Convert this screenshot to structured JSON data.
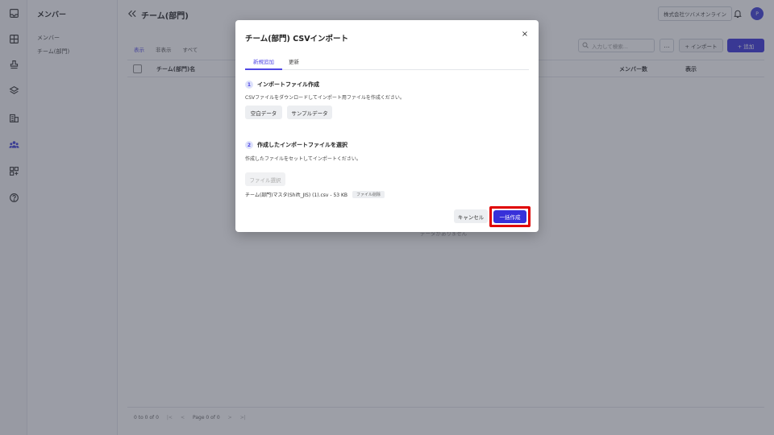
{
  "subnav": {
    "title": "メンバー",
    "items": [
      "メンバー",
      "チーム(部門)"
    ]
  },
  "main": {
    "title": "チーム(部門)",
    "company": "株式会社ツバメオンライン",
    "avatar_initial": "P",
    "tabs": [
      "表示",
      "非表示",
      "すべて"
    ],
    "search_placeholder": "入力して検索...",
    "more_label": "...",
    "import_label": "+ インポート",
    "add_label": "+ 追加",
    "columns": [
      "チーム(部門)名",
      "メンバー数",
      "表示"
    ],
    "empty_message": "データがありません",
    "pagination": {
      "range": "0 to 0 of 0",
      "page": "Page 0 of 0",
      "first": "|<",
      "prev": "<",
      "next": ">",
      "last": ">|"
    }
  },
  "modal": {
    "title": "チーム(部門) CSVインポート",
    "close": "×",
    "tabs": [
      "新規追加",
      "更新"
    ],
    "step1": {
      "num": "1",
      "title": "インポートファイル作成",
      "desc": "CSVファイルをダウンロードしてインポート用ファイルを作成ください。",
      "buttons": [
        "空白データ",
        "サンプルデータ"
      ]
    },
    "step2": {
      "num": "2",
      "title": "作成したインポートファイルを選択",
      "desc": "作成したファイルをセットしてインポートください。",
      "select_label": "ファイル選択",
      "file_name": "チーム(部門)マスタ(Shift_JIS) (1).csv - 53 KB",
      "delete_label": "ファイル削除"
    },
    "cancel_label": "キャンセル",
    "create_label": "一括作成"
  },
  "colors": {
    "accent": "#3730d9",
    "highlight": "#e00000"
  }
}
